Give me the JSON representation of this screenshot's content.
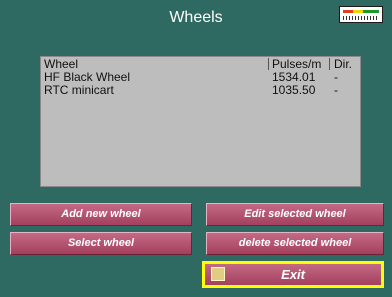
{
  "window": {
    "title": "Wheels"
  },
  "status_gauge": {
    "icon": "level-gauge-icon",
    "colors": [
      "#1a9a2a",
      "#e8d800",
      "#e04020"
    ]
  },
  "table": {
    "columns": [
      "Wheel",
      "Pulses/m",
      "Dir."
    ],
    "rows": [
      {
        "wheel": "HF Black Wheel",
        "pulses": "1534.01",
        "dir": "-"
      },
      {
        "wheel": "RTC minicart",
        "pulses": "1035.50",
        "dir": "-"
      }
    ]
  },
  "buttons": {
    "add_new": "Add new wheel",
    "edit_selected": "Edit selected wheel",
    "select": "Select wheel",
    "delete_selected": "delete selected wheel",
    "exit": "Exit"
  },
  "colors": {
    "background": "#2e6a62",
    "button": "#b45571",
    "exit_highlight": "#ffff00",
    "panel": "#bdbdbd"
  }
}
